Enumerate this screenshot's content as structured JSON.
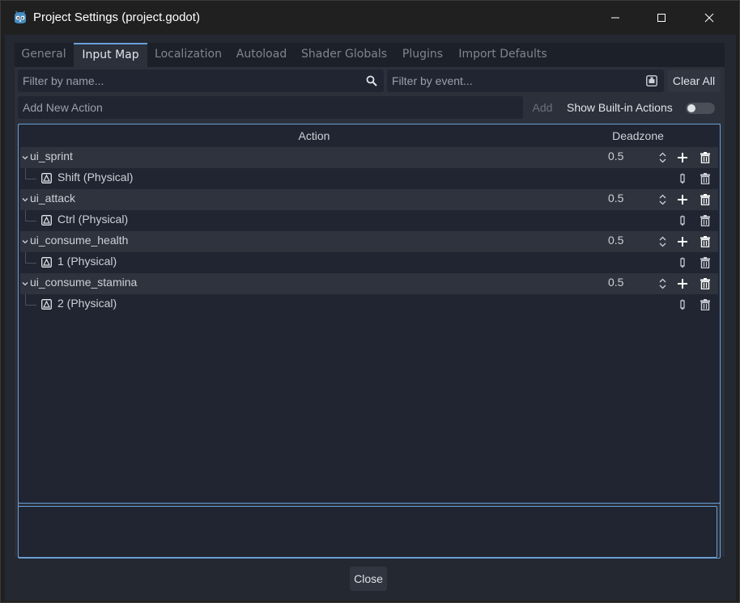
{
  "window": {
    "title": "Project Settings (project.godot)"
  },
  "tabs": [
    {
      "label": "General",
      "active": false
    },
    {
      "label": "Input Map",
      "active": true
    },
    {
      "label": "Localization",
      "active": false
    },
    {
      "label": "Autoload",
      "active": false
    },
    {
      "label": "Shader Globals",
      "active": false
    },
    {
      "label": "Plugins",
      "active": false
    },
    {
      "label": "Import Defaults",
      "active": false
    }
  ],
  "filters": {
    "name_placeholder": "Filter by name...",
    "event_placeholder": "Filter by event...",
    "clear_all_label": "Clear All"
  },
  "add_action": {
    "placeholder": "Add New Action",
    "add_label": "Add",
    "show_builtin_label": "Show Built-in Actions",
    "show_builtin_on": false
  },
  "tree": {
    "headers": {
      "action": "Action",
      "deadzone": "Deadzone"
    },
    "actions": [
      {
        "name": "ui_sprint",
        "deadzone": "0.5",
        "event": "Shift (Physical)"
      },
      {
        "name": "ui_attack",
        "deadzone": "0.5",
        "event": "Ctrl (Physical)"
      },
      {
        "name": "ui_consume_health",
        "deadzone": "0.5",
        "event": "1 (Physical)"
      },
      {
        "name": "ui_consume_stamina",
        "deadzone": "0.5",
        "event": "2 (Physical)"
      }
    ]
  },
  "footer": {
    "close_label": "Close"
  },
  "colors": {
    "accent": "#6aa0d8",
    "background": "#232831"
  },
  "icons": {
    "app": "godot-icon",
    "search": "search-icon",
    "event_filter": "keyboard-listen-icon",
    "expand": "chevron-down-icon",
    "key": "keyboard-key-icon",
    "add": "plus-icon",
    "remove": "trash-icon",
    "edit": "pencil-icon"
  }
}
